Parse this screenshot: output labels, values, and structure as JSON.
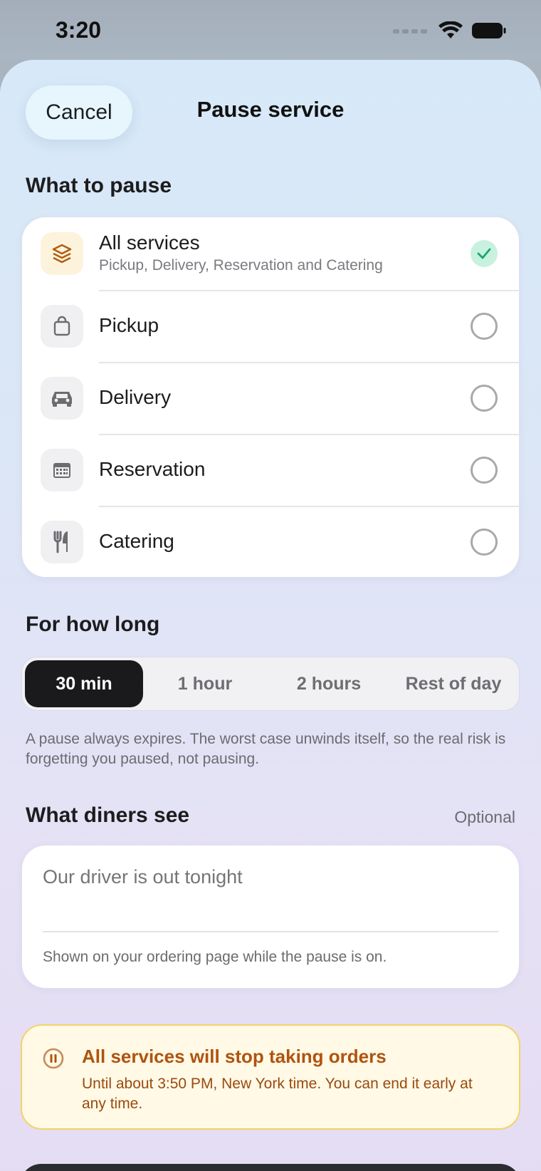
{
  "status_bar": {
    "time": "3:20"
  },
  "header": {
    "cancel_label": "Cancel",
    "title": "Pause service"
  },
  "what_to_pause": {
    "label": "What to pause",
    "items": [
      {
        "name": "All services",
        "subtitle": "Pickup, Delivery, Reservation and Catering",
        "icon": "layers-icon",
        "selected": true
      },
      {
        "name": "Pickup",
        "icon": "shopping-bag-icon",
        "selected": false
      },
      {
        "name": "Delivery",
        "icon": "car-icon",
        "selected": false
      },
      {
        "name": "Reservation",
        "icon": "calendar-icon",
        "selected": false
      },
      {
        "name": "Catering",
        "icon": "utensils-icon",
        "selected": false
      }
    ]
  },
  "duration": {
    "label": "For how long",
    "options": [
      "30 min",
      "1 hour",
      "2 hours",
      "Rest of day"
    ],
    "selected": "30 min",
    "helper": "A pause always expires. The worst case unwinds itself, so the real risk is forgetting you paused, not pausing."
  },
  "diners": {
    "label": "What diners see",
    "optional_label": "Optional",
    "placeholder": "Our driver is out tonight",
    "hint": "Shown on your ordering page while the pause is on."
  },
  "warning": {
    "icon": "pause-circle-icon",
    "title": "All services will stop taking orders",
    "body": "Until about 3:50 PM, New York time. You can end it early at any time."
  },
  "colors": {
    "accent_dark": "#1a1a1c",
    "check_green": "#17a86b",
    "warning_orange": "#b0530f",
    "warning_bg": "#fff9e6"
  }
}
